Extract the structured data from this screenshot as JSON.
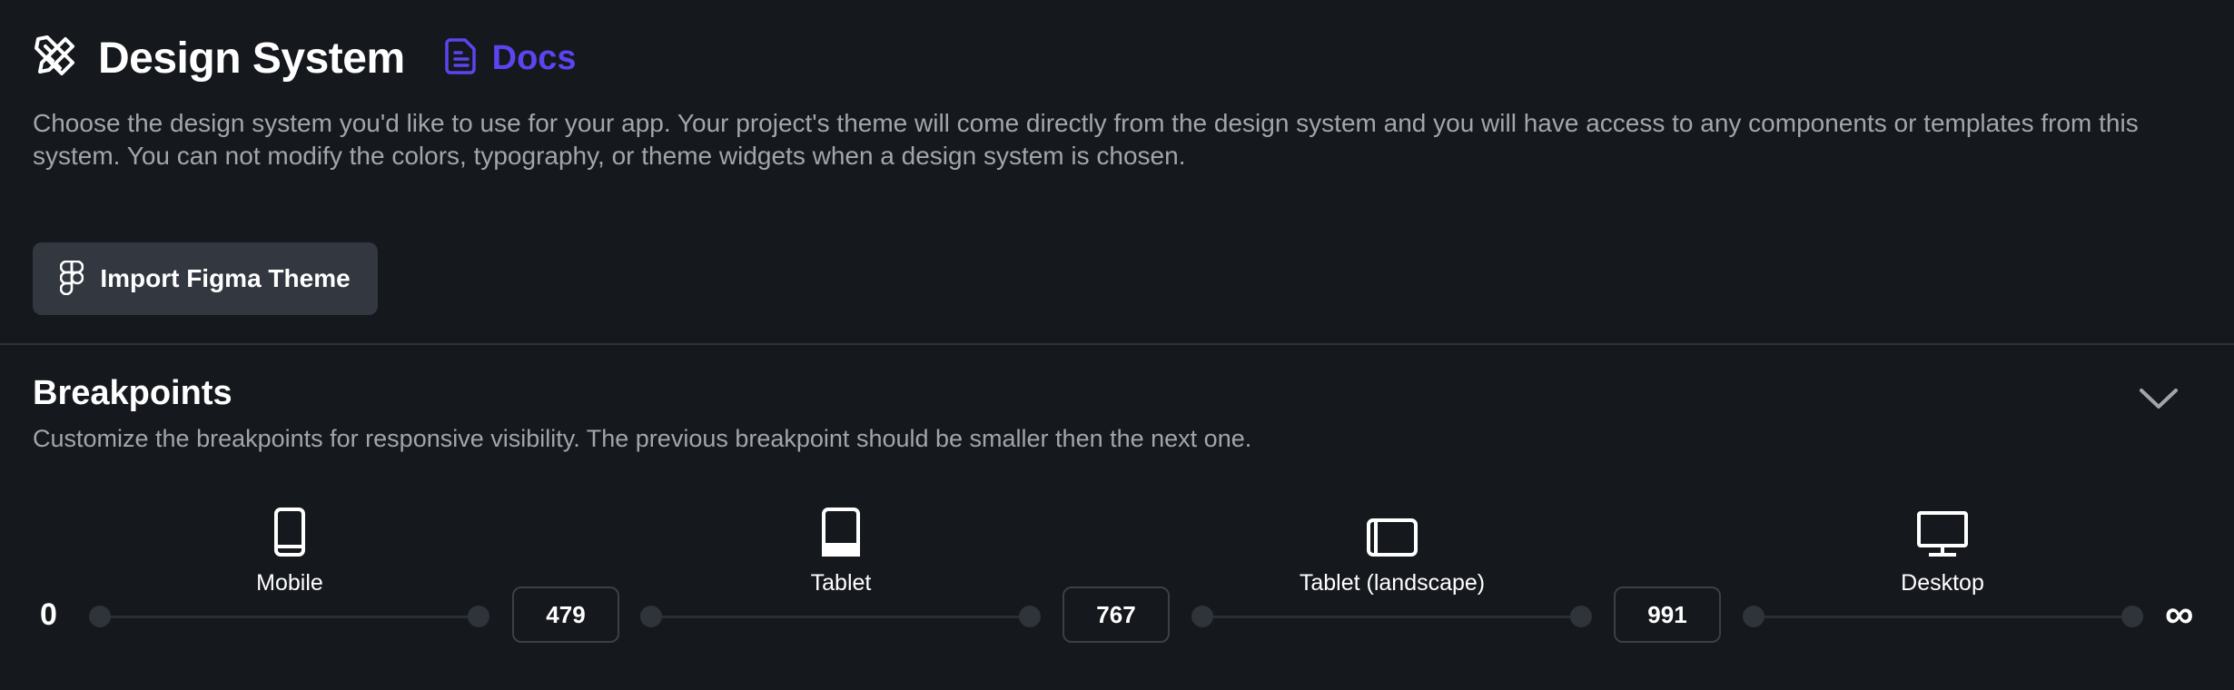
{
  "header": {
    "title": "Design System",
    "docs_label": "Docs",
    "docs_color": "#5b45f0"
  },
  "description": "Choose the design system you'd like to use for your app. Your project's theme will come directly from the design system and you will have access to any components or templates from this system. You can not modify the colors, typography, or theme widgets when a design system is chosen.",
  "import_button": {
    "label": "Import Figma Theme",
    "icon": "figma-icon"
  },
  "breakpoints": {
    "title": "Breakpoints",
    "subtitle": "Customize the breakpoints for responsive visibility. The previous breakpoint should be smaller then the next one.",
    "start_label": "0",
    "end_label": "∞",
    "devices": [
      {
        "label": "Mobile",
        "icon": "mobile-icon"
      },
      {
        "label": "Tablet",
        "icon": "tablet-icon"
      },
      {
        "label": "Tablet (landscape)",
        "icon": "tablet-landscape-icon"
      },
      {
        "label": "Desktop",
        "icon": "desktop-icon"
      }
    ],
    "values": [
      "479",
      "767",
      "991"
    ]
  }
}
